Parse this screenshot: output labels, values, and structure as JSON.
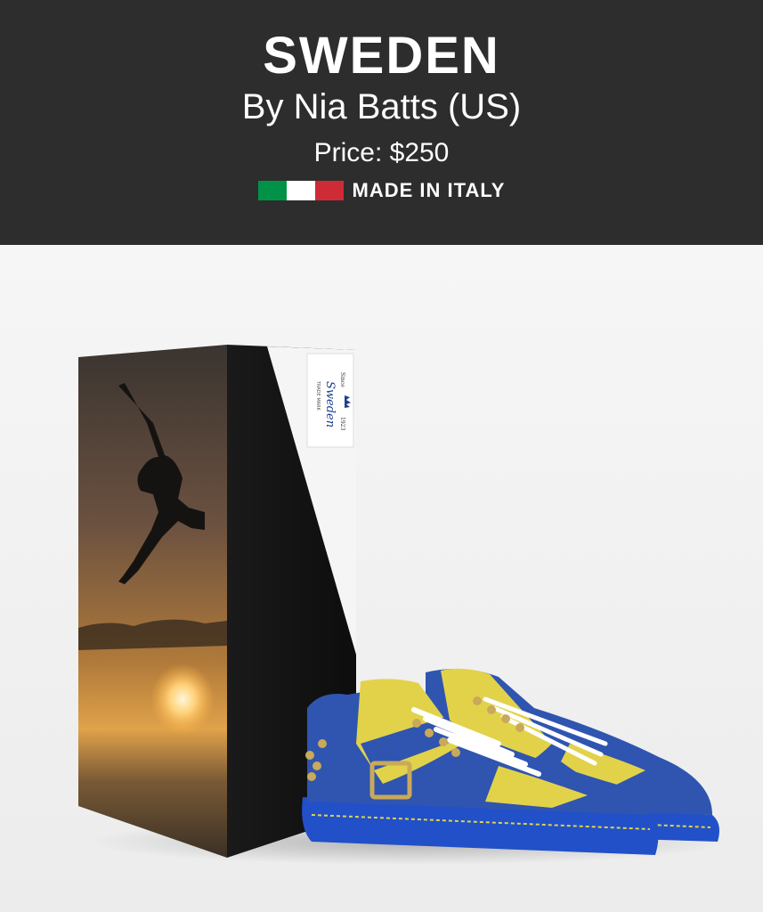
{
  "header": {
    "title": "SWEDEN",
    "byline": "By Nia Batts (US)",
    "price": "Price: $250",
    "made_in": "MADE IN ITALY",
    "flag_colors": [
      "#009246",
      "#ffffff",
      "#ce2b37"
    ],
    "background": "#2d2d2d"
  },
  "product": {
    "box_label": {
      "since": "Since",
      "year": "1923",
      "brand": "Sweden",
      "mark": "TRADE MARK"
    },
    "colors": {
      "shoe_blue": "#2f55b0",
      "shoe_yellow": "#e2d24a",
      "sole_blue": "#2150c8",
      "stud_gold": "#c9a95a"
    }
  }
}
